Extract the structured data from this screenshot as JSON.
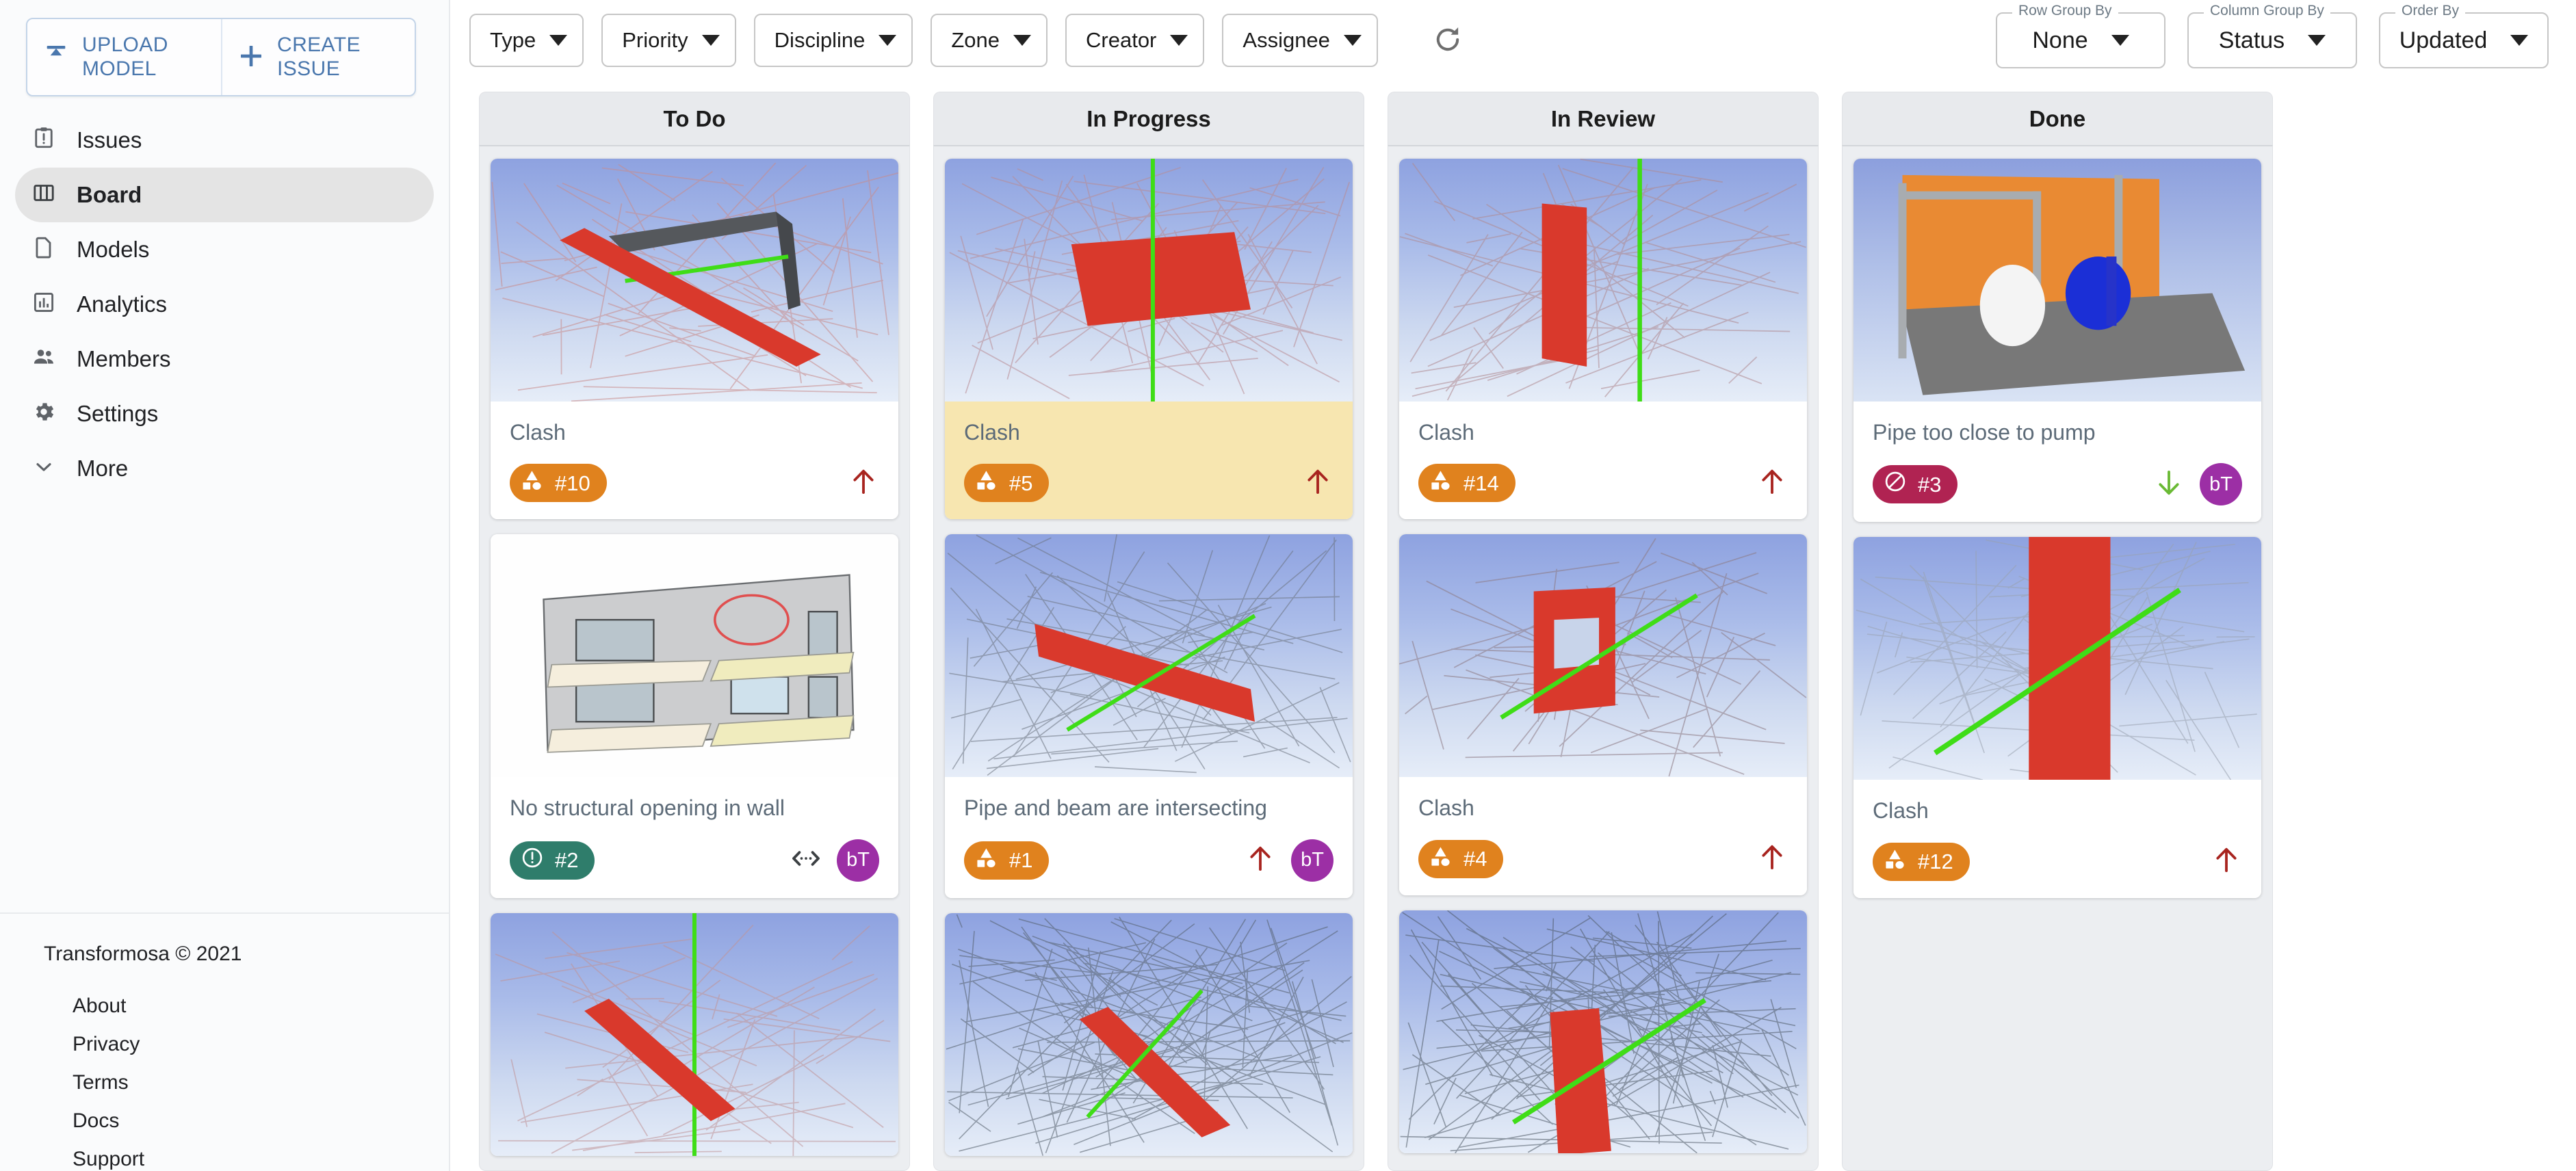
{
  "sidebar": {
    "actions": [
      {
        "label": "UPLOAD MODEL",
        "icon": "upload-icon"
      },
      {
        "label": "CREATE ISSUE",
        "icon": "plus-icon"
      }
    ],
    "nav_items": [
      {
        "label": "Issues",
        "icon": "clipboard-alert-icon",
        "active": false
      },
      {
        "label": "Board",
        "icon": "columns-icon",
        "active": true
      },
      {
        "label": "Models",
        "icon": "file-icon",
        "active": false
      },
      {
        "label": "Analytics",
        "icon": "bar-chart-icon",
        "active": false
      },
      {
        "label": "Members",
        "icon": "people-icon",
        "active": false
      },
      {
        "label": "Settings",
        "icon": "gear-icon",
        "active": false
      },
      {
        "label": "More",
        "icon": "chevron-down-icon",
        "active": false
      }
    ],
    "copyright": "Transformosa © 2021",
    "footer_links": [
      "About",
      "Privacy",
      "Terms",
      "Docs",
      "Support"
    ]
  },
  "toolbar": {
    "filters": [
      {
        "label": "Type"
      },
      {
        "label": "Priority"
      },
      {
        "label": "Discipline"
      },
      {
        "label": "Zone"
      },
      {
        "label": "Creator"
      },
      {
        "label": "Assignee"
      }
    ],
    "refresh_icon": "refresh-icon",
    "groupers": [
      {
        "legend": "Row Group By",
        "value": "None"
      },
      {
        "legend": "Column Group By",
        "value": "Status"
      },
      {
        "legend": "Order By",
        "value": "Updated"
      }
    ]
  },
  "colors": {
    "clash_badge": "#e0821e",
    "info_badge": "#2f7d6b",
    "blocked_badge": "#b02352",
    "priority_high": "#a8241f",
    "priority_low": "#6aba34",
    "avatar": "#9c2fa5",
    "highlight_card": "#f7e6b0",
    "accent_blue": "#4a77ad"
  },
  "board": {
    "columns": [
      {
        "title": "To Do",
        "cards": [
          {
            "title": "Clash",
            "badge_label": "#10",
            "badge_type": "clash",
            "badge_icon": "shapes-icon",
            "priority": "high",
            "priority_icon": "arrow-up-icon",
            "assignee": null,
            "extra_icon": null,
            "highlight": false,
            "thumb": "beam-through-frame"
          },
          {
            "title": "No structural opening in wall",
            "badge_label": "#2",
            "badge_type": "info",
            "badge_icon": "exclamation-circle-icon",
            "priority": "medium",
            "priority_icon": "left-right-icon",
            "assignee": "bT",
            "extra_icon": "code-icon",
            "highlight": false,
            "thumb": "building-elevation"
          },
          {
            "title": "",
            "badge_label": "",
            "badge_type": "clash",
            "badge_icon": "shapes-icon",
            "priority": "high",
            "priority_icon": "arrow-up-icon",
            "assignee": null,
            "extra_icon": null,
            "highlight": false,
            "thumb": "partial-red-diagonal"
          }
        ]
      },
      {
        "title": "In Progress",
        "cards": [
          {
            "title": "Clash",
            "badge_label": "#5",
            "badge_type": "clash",
            "badge_icon": "shapes-icon",
            "priority": "high",
            "priority_icon": "arrow-up-icon",
            "assignee": null,
            "extra_icon": null,
            "highlight": true,
            "thumb": "red-plate-green-pipe"
          },
          {
            "title": "Pipe and beam are intersecting",
            "badge_label": "#1",
            "badge_type": "clash",
            "badge_icon": "shapes-icon",
            "priority": "high",
            "priority_icon": "arrow-up-icon",
            "assignee": "bT",
            "extra_icon": null,
            "highlight": false,
            "thumb": "red-beam-green-pipe"
          },
          {
            "title": "",
            "badge_label": "",
            "badge_type": "clash",
            "badge_icon": "shapes-icon",
            "priority": "high",
            "priority_icon": "arrow-up-icon",
            "assignee": null,
            "extra_icon": null,
            "highlight": false,
            "thumb": "partial-dense-wireframe"
          }
        ]
      },
      {
        "title": "In Review",
        "cards": [
          {
            "title": "Clash",
            "badge_label": "#14",
            "badge_type": "clash",
            "badge_icon": "shapes-icon",
            "priority": "high",
            "priority_icon": "arrow-up-icon",
            "assignee": null,
            "extra_icon": null,
            "highlight": false,
            "thumb": "red-wall-green-pipe"
          },
          {
            "title": "Clash",
            "badge_label": "#4",
            "badge_type": "clash",
            "badge_icon": "shapes-icon",
            "priority": "high",
            "priority_icon": "arrow-up-icon",
            "assignee": null,
            "extra_icon": null,
            "highlight": false,
            "thumb": "red-frame-green-beam"
          },
          {
            "title": "",
            "badge_label": "",
            "badge_type": "clash",
            "badge_icon": "shapes-icon",
            "priority": "high",
            "priority_icon": "arrow-up-icon",
            "assignee": null,
            "extra_icon": null,
            "highlight": false,
            "thumb": "partial-dense-wireframe-2"
          }
        ]
      },
      {
        "title": "Done",
        "cards": [
          {
            "title": "Pipe too close to pump",
            "badge_label": "#3",
            "badge_type": "blocked",
            "badge_icon": "block-icon",
            "priority": "low",
            "priority_icon": "arrow-down-icon",
            "assignee": "bT",
            "extra_icon": null,
            "highlight": false,
            "thumb": "pump-room"
          },
          {
            "title": "Clash",
            "badge_label": "#12",
            "badge_type": "clash",
            "badge_icon": "shapes-icon",
            "priority": "high",
            "priority_icon": "arrow-up-icon",
            "assignee": null,
            "extra_icon": null,
            "highlight": false,
            "thumb": "red-column-green-pipe"
          }
        ]
      }
    ]
  }
}
